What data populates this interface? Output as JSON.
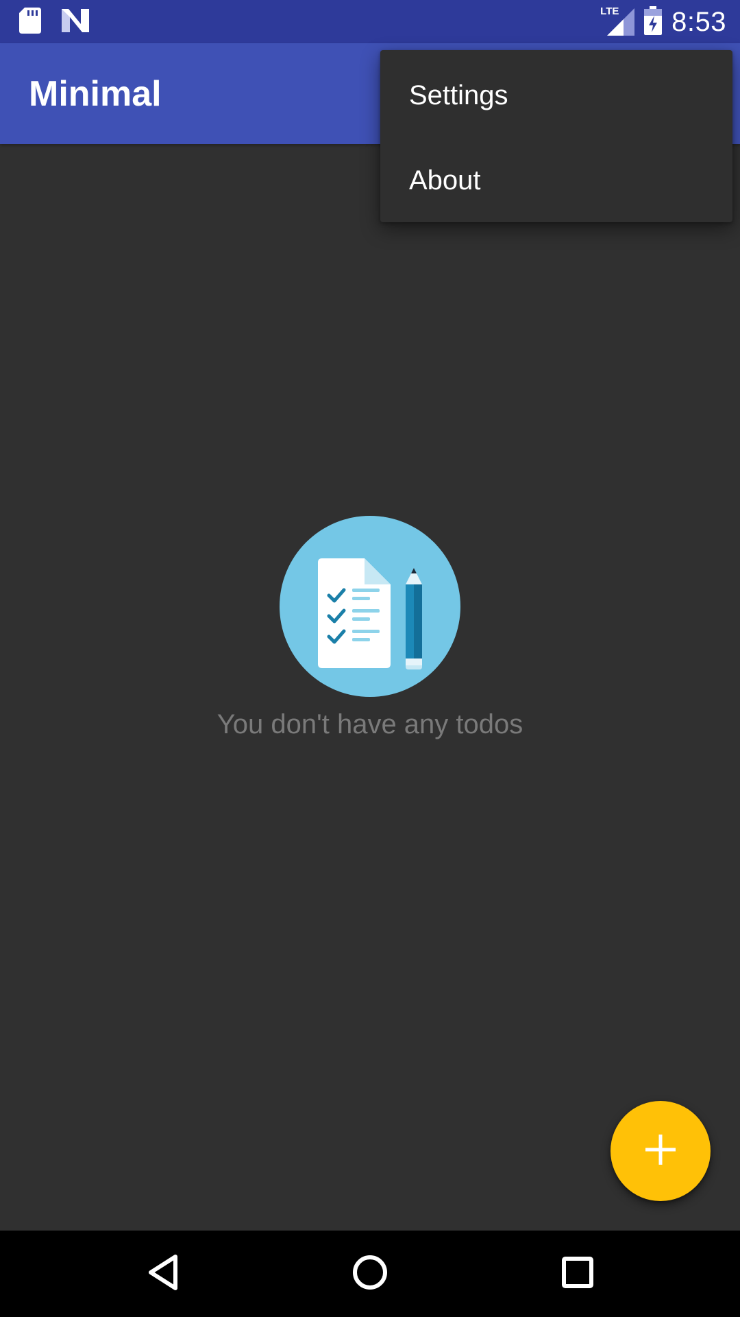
{
  "status_bar": {
    "time": "8:53",
    "network": "LTE",
    "icons": [
      "sd-card-icon",
      "notification-n-icon",
      "lte-signal-icon",
      "battery-charging-icon"
    ]
  },
  "app_bar": {
    "title": "Minimal"
  },
  "overflow_menu": {
    "items": [
      {
        "label": "Settings"
      },
      {
        "label": "About"
      }
    ]
  },
  "empty_state": {
    "icon": "checklist-pencil-icon",
    "message": "You don't have any todos"
  },
  "fab": {
    "icon": "plus-icon"
  },
  "nav_bar": {
    "icons": [
      "back-icon",
      "home-icon",
      "recents-icon"
    ]
  },
  "colors": {
    "status_bar": "#2E3A9A",
    "app_bar": "#3F51B5",
    "background": "#303030",
    "menu": "#2F2F2F",
    "fab": "#FFC107",
    "illustration_circle": "#74C7E6",
    "empty_text": "#7A7A7A"
  }
}
